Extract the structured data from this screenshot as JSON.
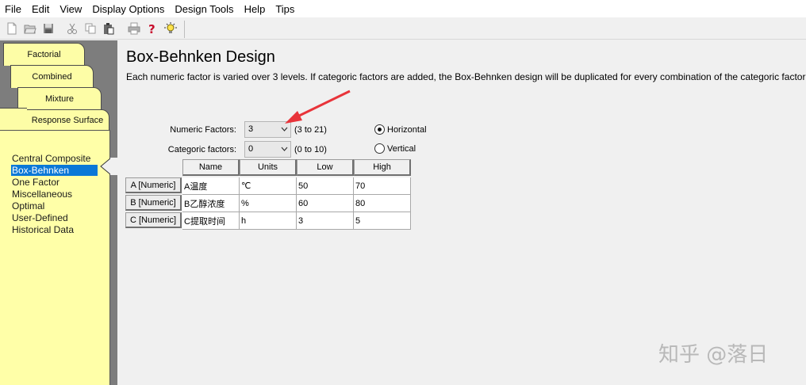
{
  "menu": [
    "File",
    "Edit",
    "View",
    "Display Options",
    "Design Tools",
    "Help",
    "Tips"
  ],
  "toolbar": {
    "icons": [
      "new-file-icon",
      "open-folder-icon",
      "save-icon",
      "cut-icon",
      "copy-icon",
      "paste-icon",
      "print-icon",
      "help-icon",
      "tips-bulb-icon"
    ]
  },
  "sidebar": {
    "tabs": [
      "Factorial",
      "Combined",
      "Mixture",
      "Response Surface"
    ],
    "items": [
      "Central Composite",
      "Box-Behnken",
      "One Factor",
      "Miscellaneous",
      "Optimal",
      "User-Defined",
      "Historical Data"
    ],
    "selected": "Box-Behnken",
    "colors": {
      "tab_bg": "#fdfda6",
      "selected_bg": "#0a78d7"
    }
  },
  "main": {
    "title": "Box-Behnken Design",
    "description": "Each numeric factor is varied over 3 levels.  If categoric factors are added, the Box-Behnken design will be duplicated for every combination of the categoric factor levels."
  },
  "form": {
    "numeric_label": "Numeric Factors:",
    "numeric_value": "3",
    "numeric_range": "(3 to 21)",
    "categoric_label": "Categoric factors:",
    "categoric_value": "0",
    "categoric_range": "(0 to 10)",
    "orientation": {
      "options": [
        "Horizontal",
        "Vertical"
      ],
      "selected": "Horizontal"
    }
  },
  "factors_table": {
    "columns": [
      "Name",
      "Units",
      "Low",
      "High"
    ],
    "rows": [
      {
        "header": "A [Numeric]",
        "name": "A温度",
        "units": "℃",
        "low": "50",
        "high": "70"
      },
      {
        "header": "B [Numeric]",
        "name": "B乙醇浓度",
        "units": "%",
        "low": "60",
        "high": "80"
      },
      {
        "header": "C [Numeric]",
        "name": "C提取时间",
        "units": "h",
        "low": "3",
        "high": "5"
      }
    ]
  },
  "watermark": "知乎 @落日",
  "annotation_color": "#e8343a"
}
